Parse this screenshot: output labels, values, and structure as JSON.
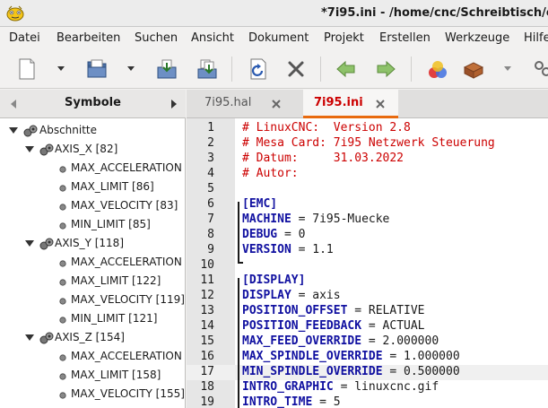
{
  "window": {
    "title": "*7i95.ini - /home/cnc/Schreibtisch/con"
  },
  "menu": [
    "Datei",
    "Bearbeiten",
    "Suchen",
    "Ansicht",
    "Dokument",
    "Projekt",
    "Erstellen",
    "Werkzeuge",
    "Hilfe"
  ],
  "toolbar": {
    "icons": [
      "new-file-icon",
      "open-file-icon",
      "save-icon",
      "save-all-icon",
      "reload-icon",
      "close-icon",
      "back-icon",
      "forward-icon",
      "color-chooser-icon",
      "compile-icon",
      "preferences-icon"
    ]
  },
  "sidebar": {
    "tab_label": "Symbole",
    "root": "Abschnitte",
    "groups": [
      {
        "label": "AXIS_X [82]",
        "items": [
          "MAX_ACCELERATION",
          "MAX_LIMIT [86]",
          "MAX_VELOCITY [83]",
          "MIN_LIMIT [85]"
        ]
      },
      {
        "label": "AXIS_Y [118]",
        "items": [
          "MAX_ACCELERATION",
          "MAX_LIMIT [122]",
          "MAX_VELOCITY [119]",
          "MIN_LIMIT [121]"
        ]
      },
      {
        "label": "AXIS_Z [154]",
        "items": [
          "MAX_ACCELERATION",
          "MAX_LIMIT [158]",
          "MAX_VELOCITY [155]"
        ]
      }
    ]
  },
  "tabs": [
    {
      "label": "7i95.hal",
      "active": false
    },
    {
      "label": "7i95.ini",
      "active": true
    }
  ],
  "editor": {
    "lines": [
      {
        "n": "1",
        "type": "comment",
        "text": "# LinuxCNC:  Version 2.8"
      },
      {
        "n": "2",
        "type": "comment",
        "text": "# Mesa Card: 7i95 Netzwerk Steuerung"
      },
      {
        "n": "3",
        "type": "comment",
        "text": "# Datum:     31.03.2022"
      },
      {
        "n": "4",
        "type": "comment",
        "text": "# Autor:"
      },
      {
        "n": "5",
        "type": "blank",
        "text": ""
      },
      {
        "n": "6",
        "type": "section",
        "text": "[EMC]"
      },
      {
        "n": "7",
        "type": "kv",
        "key": "MACHINE",
        "value": " = 7i95-Muecke"
      },
      {
        "n": "8",
        "type": "kv",
        "key": "DEBUG",
        "value": " = 0"
      },
      {
        "n": "9",
        "type": "kv",
        "key": "VERSION",
        "value": " = 1.1"
      },
      {
        "n": "10",
        "type": "blank",
        "text": ""
      },
      {
        "n": "11",
        "type": "section",
        "text": "[DISPLAY]"
      },
      {
        "n": "12",
        "type": "kv",
        "key": "DISPLAY",
        "value": " = axis"
      },
      {
        "n": "13",
        "type": "kv",
        "key": "POSITION_OFFSET",
        "value": " = RELATIVE"
      },
      {
        "n": "14",
        "type": "kv",
        "key": "POSITION_FEEDBACK",
        "value": " = ACTUAL"
      },
      {
        "n": "15",
        "type": "kv",
        "key": "MAX_FEED_OVERRIDE",
        "value": " = 2.000000"
      },
      {
        "n": "16",
        "type": "kv",
        "key": "MAX_SPINDLE_OVERRIDE",
        "value": " = 1.000000"
      },
      {
        "n": "17",
        "type": "kv",
        "key": "MIN_SPINDLE_OVERRIDE",
        "value": " = 0.500000",
        "current": true
      },
      {
        "n": "18",
        "type": "kv",
        "key": "INTRO_GRAPHIC",
        "value": " = linuxcnc.gif"
      },
      {
        "n": "19",
        "type": "kv",
        "key": "INTRO_TIME",
        "value": " = 5"
      }
    ]
  },
  "colors": {
    "comment": "#cc0000",
    "section": "#1010a0",
    "active_tab_underline": "#e86a0f"
  }
}
